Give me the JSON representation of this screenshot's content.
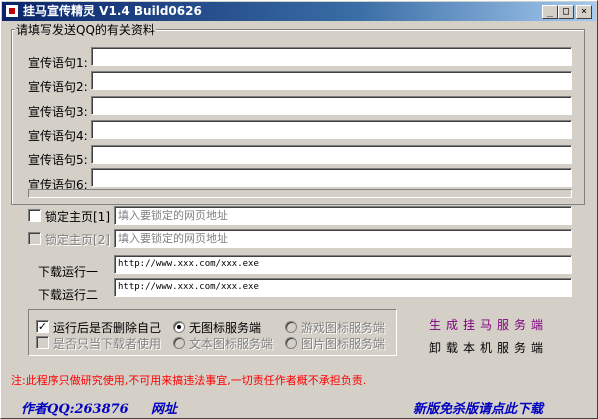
{
  "window": {
    "title": "挂马宣传精灵 V1.4  Build0626",
    "minimize": "_",
    "maximize": "□",
    "close": "×"
  },
  "group": {
    "label": "请填写发送QQ的有关资料"
  },
  "slogans": [
    {
      "label": "宣传语句1:",
      "value": ""
    },
    {
      "label": "宣传语句2:",
      "value": ""
    },
    {
      "label": "宣传语句3:",
      "value": ""
    },
    {
      "label": "宣传语句4:",
      "value": ""
    },
    {
      "label": "宣传语句5:",
      "value": ""
    },
    {
      "label": "宣传语句6:",
      "value": ""
    }
  ],
  "homepage1": {
    "label": "锁定主页[1]",
    "placeholder": "填入要锁定的网页地址",
    "checked": false
  },
  "homepage2": {
    "label": "锁定主页[2]",
    "placeholder": "填入要锁定的网页地址",
    "checked": false
  },
  "download1": {
    "label": "下载运行一",
    "value": "http://www.xxx.com/xxx.exe"
  },
  "download2": {
    "label": "下载运行二",
    "value": "http://www.xxx.com/xxx.exe"
  },
  "options": {
    "delete_self": {
      "label": "运行后是否删除自己",
      "checked": true
    },
    "only_downloader": {
      "label": "是否只当下载者使用",
      "checked": false
    },
    "no_icon": {
      "label": "无图标服务端",
      "selected": true
    },
    "game_icon": {
      "label": "游戏图标服务端",
      "selected": false
    },
    "text_icon": {
      "label": "文本图标服务端",
      "selected": false
    },
    "image_icon": {
      "label": "图片图标服务端",
      "selected": false
    }
  },
  "actions": {
    "generate": "生成挂马服务端",
    "uninstall": "卸载本机服务端"
  },
  "note": "注:此程序只做研究使用,不可用来搞违法事宜,一切责任作者概不承担负责.",
  "footer": {
    "author": "作者QQ:263876",
    "website": "网址",
    "download": "新版免杀版请点此下载"
  },
  "colors": {
    "title_gradient_start": "#0a246a",
    "title_gradient_end": "#a6caf0",
    "generate_link": "#800080",
    "note": "#ff0000",
    "footer": "#0000c0"
  }
}
